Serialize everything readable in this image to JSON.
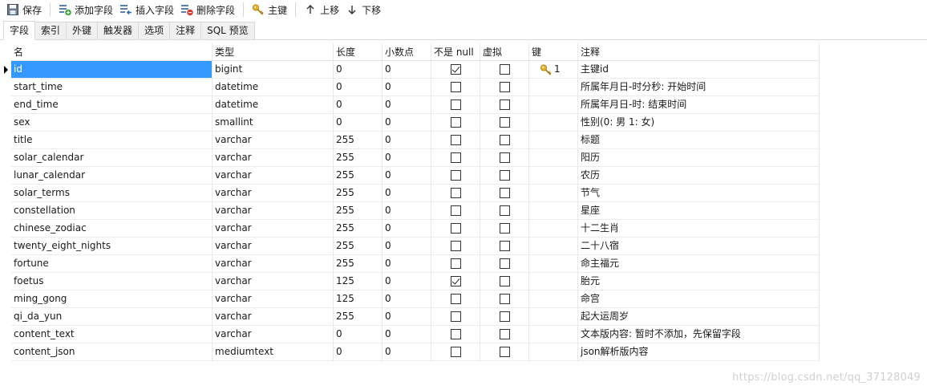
{
  "toolbar": {
    "save_label": "保存",
    "add_field_label": "添加字段",
    "insert_field_label": "插入字段",
    "delete_field_label": "删除字段",
    "primary_key_label": "主键",
    "move_up_label": "上移",
    "move_down_label": "下移"
  },
  "tabs": [
    "字段",
    "索引",
    "外键",
    "触发器",
    "选项",
    "注释",
    "SQL 预览"
  ],
  "active_tab": "字段",
  "grid": {
    "columns": [
      "名",
      "类型",
      "长度",
      "小数点",
      "不是 null",
      "虚拟",
      "键",
      "注释"
    ],
    "rows": [
      {
        "name": "id",
        "type": "bigint",
        "length": "0",
        "decimals": "0",
        "not_null": true,
        "virtual": false,
        "key": "1",
        "comment": "主键id"
      },
      {
        "name": "start_time",
        "type": "datetime",
        "length": "0",
        "decimals": "0",
        "not_null": false,
        "virtual": false,
        "key": "",
        "comment": "所属年月日-时分秒: 开始时间"
      },
      {
        "name": "end_time",
        "type": "datetime",
        "length": "0",
        "decimals": "0",
        "not_null": false,
        "virtual": false,
        "key": "",
        "comment": "所属年月日-时: 结束时间"
      },
      {
        "name": "sex",
        "type": "smallint",
        "length": "0",
        "decimals": "0",
        "not_null": false,
        "virtual": false,
        "key": "",
        "comment": "性别(0:   男    1:   女)"
      },
      {
        "name": "title",
        "type": "varchar",
        "length": "255",
        "decimals": "0",
        "not_null": false,
        "virtual": false,
        "key": "",
        "comment": "标题"
      },
      {
        "name": "solar_calendar",
        "type": "varchar",
        "length": "255",
        "decimals": "0",
        "not_null": false,
        "virtual": false,
        "key": "",
        "comment": "阳历"
      },
      {
        "name": "lunar_calendar",
        "type": "varchar",
        "length": "255",
        "decimals": "0",
        "not_null": false,
        "virtual": false,
        "key": "",
        "comment": "农历"
      },
      {
        "name": "solar_terms",
        "type": "varchar",
        "length": "255",
        "decimals": "0",
        "not_null": false,
        "virtual": false,
        "key": "",
        "comment": "节气"
      },
      {
        "name": "constellation",
        "type": "varchar",
        "length": "255",
        "decimals": "0",
        "not_null": false,
        "virtual": false,
        "key": "",
        "comment": "星座"
      },
      {
        "name": "chinese_zodiac",
        "type": "varchar",
        "length": "255",
        "decimals": "0",
        "not_null": false,
        "virtual": false,
        "key": "",
        "comment": "十二生肖"
      },
      {
        "name": "twenty_eight_nights",
        "type": "varchar",
        "length": "255",
        "decimals": "0",
        "not_null": false,
        "virtual": false,
        "key": "",
        "comment": "二十八宿"
      },
      {
        "name": "fortune",
        "type": "varchar",
        "length": "255",
        "decimals": "0",
        "not_null": false,
        "virtual": false,
        "key": "",
        "comment": "命主福元"
      },
      {
        "name": "foetus",
        "type": "varchar",
        "length": "125",
        "decimals": "0",
        "not_null": true,
        "virtual": false,
        "key": "",
        "comment": "胎元"
      },
      {
        "name": "ming_gong",
        "type": "varchar",
        "length": "125",
        "decimals": "0",
        "not_null": false,
        "virtual": false,
        "key": "",
        "comment": "命宫"
      },
      {
        "name": "qi_da_yun",
        "type": "varchar",
        "length": "255",
        "decimals": "0",
        "not_null": false,
        "virtual": false,
        "key": "",
        "comment": "起大运周岁"
      },
      {
        "name": "content_text",
        "type": "varchar",
        "length": "0",
        "decimals": "0",
        "not_null": false,
        "virtual": false,
        "key": "",
        "comment": "文本版内容: 暂时不添加，先保留字段"
      },
      {
        "name": "content_json",
        "type": "mediumtext",
        "length": "0",
        "decimals": "0",
        "not_null": false,
        "virtual": false,
        "key": "",
        "comment": "json解析版内容"
      }
    ]
  },
  "watermark": "https://blog.csdn.net/qq_37128049",
  "colors": {
    "selection": "#3399ff",
    "key_icon": "#e8b325"
  }
}
